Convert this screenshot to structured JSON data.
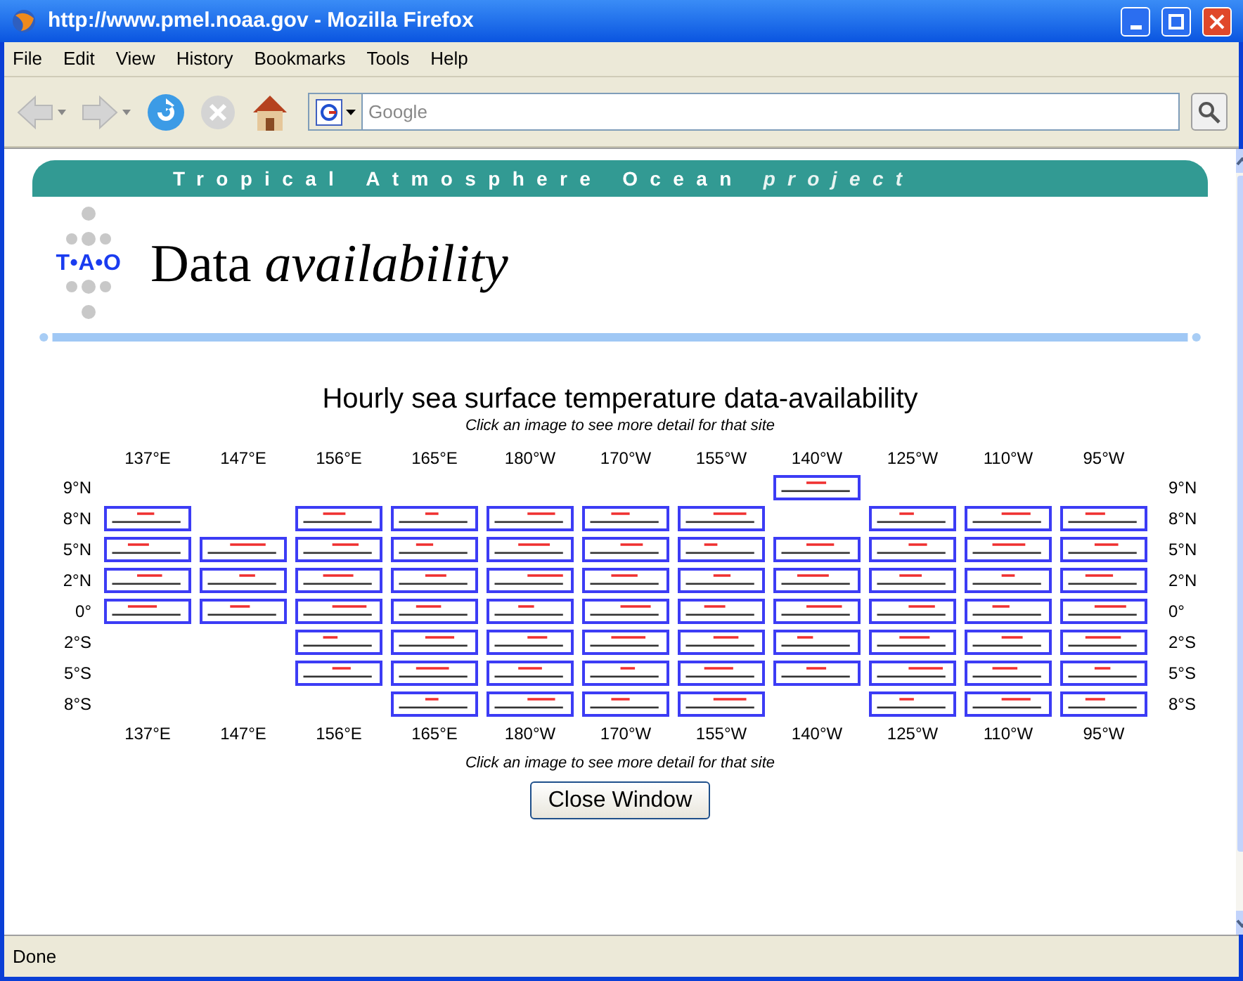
{
  "window": {
    "title": "http://www.pmel.noaa.gov - Mozilla Firefox"
  },
  "menu": [
    "File",
    "Edit",
    "View",
    "History",
    "Bookmarks",
    "Tools",
    "Help"
  ],
  "search": {
    "placeholder": "Google"
  },
  "page": {
    "banner": [
      {
        "text": "Tropical",
        "italic": false
      },
      {
        "text": "Atmosphere",
        "italic": false
      },
      {
        "text": "Ocean",
        "italic": false
      },
      {
        "text": "project",
        "italic": true
      }
    ],
    "logo": "T•A•O",
    "heading": "Data *availability*",
    "title": "Hourly sea surface temperature data-availability",
    "hint_top": "Click an image to see more detail for that site",
    "columns": [
      "137°E",
      "147°E",
      "156°E",
      "165°E",
      "180°W",
      "170°W",
      "155°W",
      "140°W",
      "125°W",
      "110°W",
      "95°W"
    ],
    "rows": [
      {
        "label": "9°N",
        "label_right": "9°N",
        "sites": [
          false,
          false,
          false,
          false,
          false,
          false,
          false,
          true,
          false,
          false,
          false
        ]
      },
      {
        "label": "8°N",
        "label_right": "8°N",
        "sites": [
          true,
          false,
          true,
          true,
          true,
          true,
          true,
          false,
          true,
          true,
          true
        ]
      },
      {
        "label": "5°N",
        "label_right": "5°N",
        "sites": [
          true,
          true,
          true,
          true,
          true,
          true,
          true,
          true,
          true,
          true,
          true
        ]
      },
      {
        "label": "2°N",
        "label_right": "2°N",
        "sites": [
          true,
          true,
          true,
          true,
          true,
          true,
          true,
          true,
          true,
          true,
          true
        ]
      },
      {
        "label": "0°",
        "label_right": "0°",
        "sites": [
          true,
          true,
          true,
          true,
          true,
          true,
          true,
          true,
          true,
          true,
          true
        ]
      },
      {
        "label": "2°S",
        "label_right": "2°S",
        "sites": [
          false,
          false,
          true,
          true,
          true,
          true,
          true,
          true,
          true,
          true,
          true
        ]
      },
      {
        "label": "5°S",
        "label_right": "5°S",
        "sites": [
          false,
          false,
          true,
          true,
          true,
          true,
          true,
          true,
          true,
          true,
          true
        ]
      },
      {
        "label": "8°S",
        "label_right": "8°S",
        "sites": [
          false,
          false,
          false,
          true,
          true,
          true,
          true,
          false,
          true,
          true,
          true
        ]
      }
    ],
    "columns_bottom": [
      "137°E",
      "147°E",
      "156°E",
      "165°E",
      "180°W",
      "170°W",
      "155°W",
      "140°W",
      "125°W",
      "110°W",
      "95°W"
    ],
    "hint_bottom": "Click an image to see more detail for that site",
    "button": "Close Window"
  },
  "status_bar": "Done"
}
